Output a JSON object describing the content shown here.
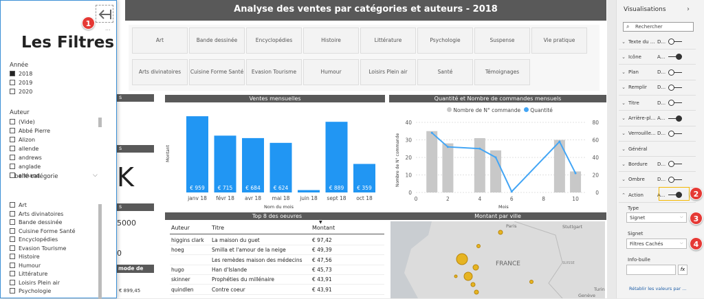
{
  "report": {
    "title": "Analyse des ventes par catégories et auteurs - 2018"
  },
  "filter_panel": {
    "title": "Les Filtres",
    "more": "...",
    "annee_label": "Année",
    "annee_items": [
      {
        "label": "2018",
        "checked": true
      },
      {
        "label": "2019",
        "checked": false
      },
      {
        "label": "2020",
        "checked": false
      }
    ],
    "auteur_label": "Auteur",
    "auteur_items": [
      "(Vide)",
      "Abbé Pierre",
      "Alizon",
      "allende",
      "andrews",
      "anglade",
      "armand"
    ],
    "categorie_label": "Libellé catégorie",
    "categorie_items": [
      "Art",
      "Arts divinatoires",
      "Bande dessinée",
      "Cuisine Forme Santé",
      "Encyclopédies",
      "Evasion Tourisme",
      "Histoire",
      "Humour",
      "Littérature",
      "Loisirs Plein air",
      "Psychologie"
    ]
  },
  "category_buttons_row1": [
    "Art",
    "Bande dessinée",
    "Encyclopédies",
    "Histoire",
    "Littérature",
    "Psychologie",
    "Suspense",
    "Vie pratique"
  ],
  "category_buttons_row2": [
    "Arts divinatoires",
    "Cuisine Forme Santé",
    "Evasion Tourisme",
    "Humour",
    "Loisirs Plein air",
    "Santé",
    "Témoignages"
  ],
  "left_cards": {
    "s_text": "s",
    "big_k": "K",
    "value_5000": "5000",
    "value_0": "0",
    "mode_de": "mode de",
    "bottom_value": "€ 899,45"
  },
  "monthly_chart": {
    "header": "Ventes mensuelles",
    "ylabel": "Montant",
    "xlabel": "Nom du mois"
  },
  "combo_chart": {
    "header": "Quantité et Nombre de commandes mensuels",
    "legend": [
      "Nombre de N° commande",
      "Quantité"
    ],
    "ylabel": "Nombre de N° commande",
    "xlabel": "Mois",
    "yticks_left": [
      "40",
      "30",
      "20",
      "10",
      "0"
    ],
    "yticks_right": [
      "80",
      "60",
      "40",
      "20",
      "0"
    ],
    "xticks": [
      "0",
      "2",
      "4",
      "6",
      "8",
      "10"
    ]
  },
  "chart_data": [
    {
      "type": "bar",
      "title": "Ventes mensuelles",
      "ylabel": "Montant",
      "xlabel": "Nom du mois",
      "categories": [
        "janv 18",
        "févr 18",
        "avr 18",
        "mai 18",
        "juin 18",
        "sept 18",
        "oct 18"
      ],
      "values": [
        959,
        715,
        684,
        624,
        30,
        889,
        359
      ],
      "labels": [
        "€ 959",
        "€ 715",
        "€ 684",
        "€ 624",
        "",
        "€ 889",
        "€ 359"
      ],
      "color": "#2196f3"
    },
    {
      "type": "bar",
      "title": "Quantité et Nombre de commandes mensuels",
      "xlabel": "Mois",
      "ylabel": "Nombre de N° commande",
      "bar_x": [
        1,
        2,
        4,
        5,
        9,
        10
      ],
      "series": [
        {
          "name": "Nombre de N° commande",
          "values": [
            35,
            28,
            31,
            24,
            30,
            12
          ],
          "color": "#c8c8c8"
        },
        {
          "name": "Quantité",
          "x": [
            1,
            2,
            4,
            5,
            6,
            9,
            10
          ],
          "values": [
            68,
            52,
            50,
            40,
            1,
            58,
            22
          ],
          "color": "#42a5f5"
        }
      ],
      "ylim_left": [
        0,
        40
      ],
      "ylim_right": [
        0,
        80
      ]
    }
  ],
  "top8": {
    "header": "Top 8 des oeuvres",
    "columns": [
      "Auteur",
      "Titre",
      "Montant"
    ],
    "rows": [
      [
        "higgins clark",
        "La maison du guet",
        "€ 97,42"
      ],
      [
        "hoeg",
        "Smilla et l'amour de la neige",
        "€ 49,39"
      ],
      [
        "",
        "Les remèdes maison des médecins",
        "€ 47,56"
      ],
      [
        "hugo",
        "Han d'Islande",
        "€ 45,73"
      ],
      [
        "skinner",
        "Prophéties du millénaire",
        "€ 43,91"
      ],
      [
        "quindlen",
        "Contre coeur",
        "€ 43,91"
      ]
    ]
  },
  "map": {
    "header": "Montant par ville",
    "labels": [
      "Paris",
      "Stuttgart",
      "FRANCE",
      "SUISSE",
      "Genève",
      "Turin"
    ]
  },
  "viz_pane": {
    "title": "Visualisations",
    "search_placeholder": "Rechercher",
    "rows": [
      {
        "label": "Texte du ...",
        "state": "D...",
        "toggle": "off",
        "expanded": false
      },
      {
        "label": "Icône",
        "state": "A...",
        "toggle": "on",
        "expanded": false
      },
      {
        "label": "Plan",
        "state": "D...",
        "toggle": "off",
        "expanded": false
      },
      {
        "label": "Remplir",
        "state": "D...",
        "toggle": "off",
        "expanded": false
      },
      {
        "label": "Titre",
        "state": "D...",
        "toggle": "off",
        "expanded": false
      },
      {
        "label": "Arrière-pl...",
        "state": "A...",
        "toggle": "on",
        "expanded": false
      },
      {
        "label": "Verrouille...",
        "state": "D...",
        "toggle": "off",
        "expanded": false
      },
      {
        "label": "Général",
        "state": "",
        "toggle": "none",
        "expanded": false
      },
      {
        "label": "Bordure",
        "state": "D...",
        "toggle": "off",
        "expanded": false
      },
      {
        "label": "Ombre",
        "state": "D...",
        "toggle": "off",
        "expanded": false
      },
      {
        "label": "Action",
        "state": "A...",
        "toggle": "on",
        "expanded": true
      }
    ],
    "type_label": "Type",
    "type_value": "Signet",
    "signet_label": "Signet",
    "signet_value": "Filtres Cachés",
    "infobulle_label": "Info-bulle",
    "fx": "fx",
    "reset": "Rétablir les valeurs par ..."
  },
  "callouts": [
    "1",
    "2",
    "3",
    "4"
  ]
}
